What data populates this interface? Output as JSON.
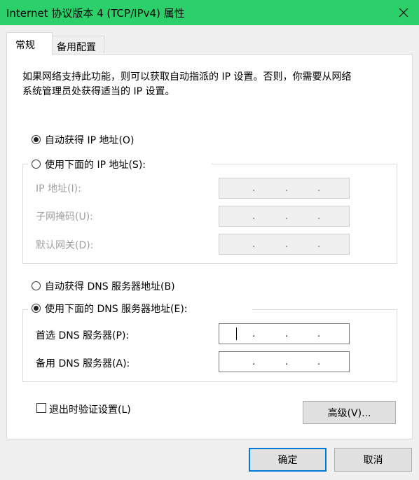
{
  "window": {
    "title": "Internet 协议版本 4 (TCP/IPv4) 属性",
    "close_icon": "close-icon"
  },
  "tabs": [
    {
      "label": "常规",
      "active": true
    },
    {
      "label": "备用配置",
      "active": false
    }
  ],
  "description": {
    "line1": "如果网络支持此功能，则可以获取自动指派的 IP 设置。否则，你需要从网络",
    "line2": "系统管理员处获得适当的 IP 设置。"
  },
  "ip_mode": {
    "auto_label": "自动获得 IP 地址(O)",
    "manual_label": "使用下面的 IP 地址(S):",
    "selected": "auto"
  },
  "ip_fields": {
    "ip_label": "IP 地址(I):",
    "mask_label": "子网掩码(U):",
    "gateway_label": "默认网关(D):",
    "separator": "."
  },
  "dns_mode": {
    "auto_label": "自动获得 DNS 服务器地址(B)",
    "manual_label": "使用下面的 DNS 服务器地址(E):",
    "selected": "manual"
  },
  "dns_fields": {
    "preferred_label": "首选 DNS 服务器(P):",
    "alternate_label": "备用 DNS 服务器(A):",
    "separator": "."
  },
  "validate": {
    "label": "退出时验证设置(L)",
    "checked": false
  },
  "buttons": {
    "advanced": "高级(V)...",
    "ok": "确定",
    "cancel": "取消"
  },
  "colors": {
    "titlebar": "#2bd06b",
    "default_button_border": "#0078d7",
    "disabled_text": "#a0a0a0"
  }
}
